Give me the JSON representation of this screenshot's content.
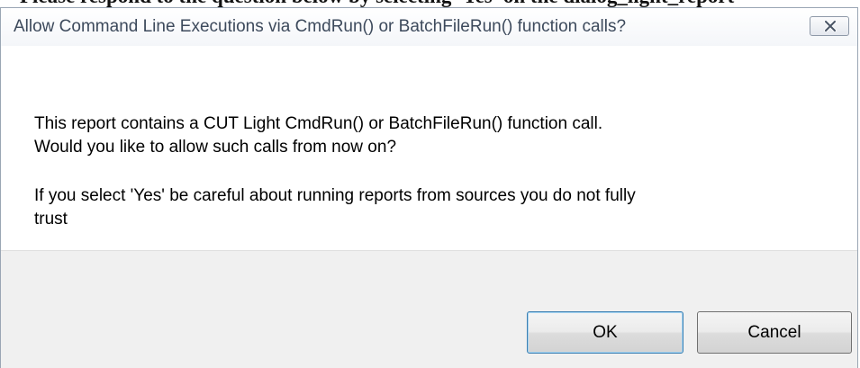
{
  "window": {
    "title": "Allow Command Line Executions via CmdRun() or BatchFileRun() function calls?",
    "close_icon": "close-x-icon"
  },
  "page_fragment": "Please respond to the question below by selecting 'Yes' on the dialog_light_report",
  "message": {
    "line1": "This report contains a CUT Light CmdRun() or BatchFileRun() function call.",
    "line2": "Would you like to allow such calls from now on?",
    "line3": "If you select 'Yes' be careful about running reports from sources you do not fully",
    "line4": "trust"
  },
  "buttons": {
    "ok_label": "OK",
    "cancel_label": "Cancel"
  },
  "colors": {
    "title_text": "#3d4a5c",
    "footer_bg": "#f0f0f0",
    "default_button_border": "#3c7fb1"
  }
}
